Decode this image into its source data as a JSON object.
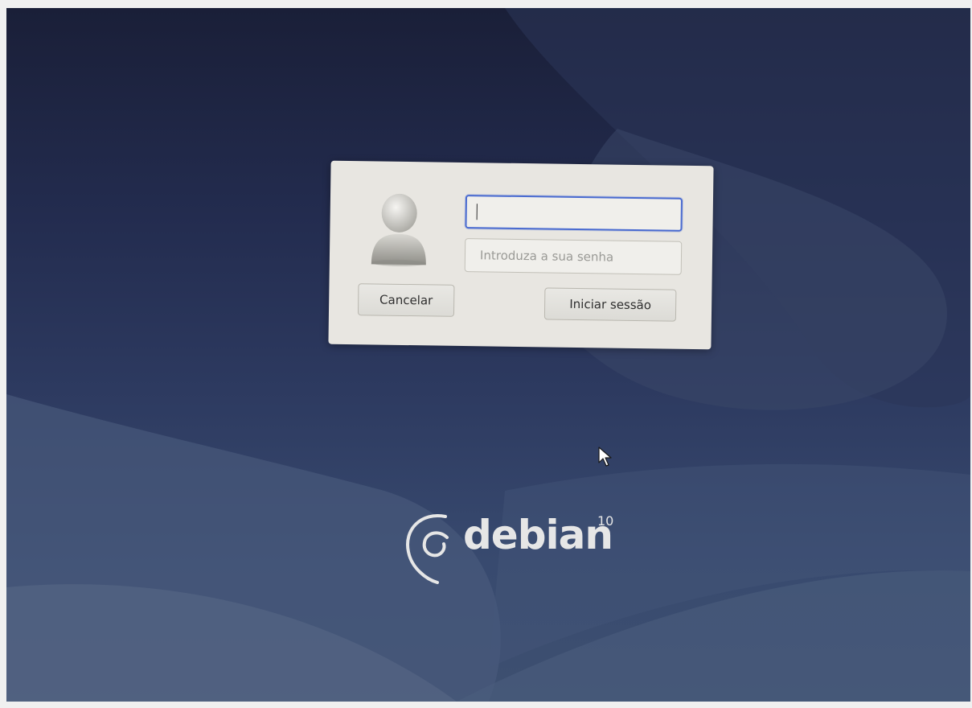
{
  "login": {
    "username_value": "",
    "password_placeholder": "Introduza a sua senha",
    "cancel_label": "Cancelar",
    "login_label": "Iniciar sessão",
    "avatar_icon": "user-avatar-icon"
  },
  "branding": {
    "name": "debian",
    "version": "10",
    "logo_icon": "debian-swirl-icon"
  },
  "colors": {
    "focus_border": "#4a6bd0",
    "dialog_bg": "#e8e6e1",
    "wallpaper_dark": "#1a1f38",
    "wallpaper_light": "#3e5070"
  }
}
